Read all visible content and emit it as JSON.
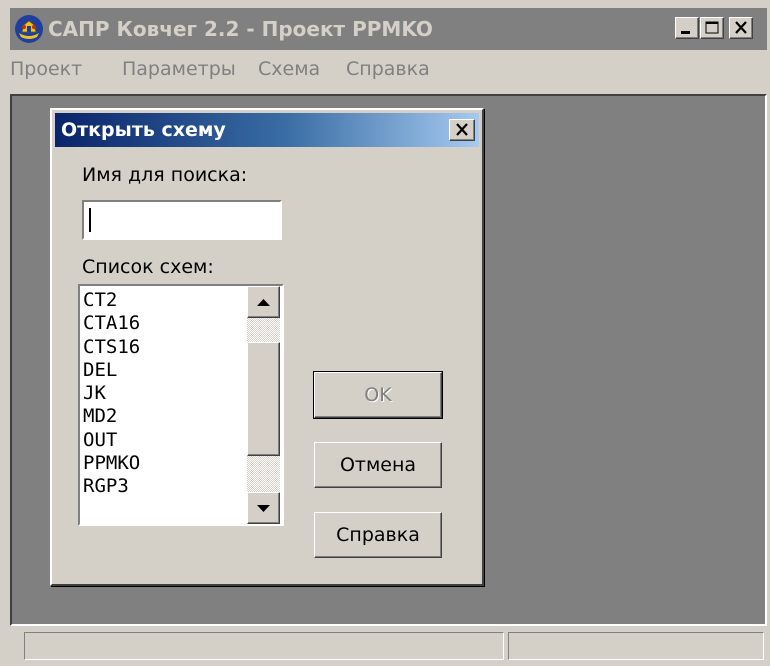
{
  "window": {
    "title": "САПР Ковчег 2.2 - Проект PPMKO",
    "controls": {
      "minimize": "minimize-icon",
      "maximize": "maximize-icon",
      "close": "close-icon"
    }
  },
  "menu": {
    "items": [
      "Проект",
      "Параметры",
      "Схема",
      "Справка"
    ]
  },
  "dialog": {
    "title": "Открыть схему",
    "search_label": "Имя для поиска:",
    "search_value": "",
    "list_label": "Список схем:",
    "list_items": [
      "CT2",
      "CTA16",
      "CTS16",
      "DEL",
      "JK",
      "MD2",
      "OUT",
      "PPMKO",
      "RGP3"
    ],
    "buttons": {
      "ok": "OK",
      "cancel": "Отмена",
      "help": "Справка"
    }
  },
  "colors": {
    "face": "#d4d0c8",
    "client": "#808080",
    "dialog_title_start": "#0a246a",
    "dialog_title_end": "#a6caf0"
  }
}
